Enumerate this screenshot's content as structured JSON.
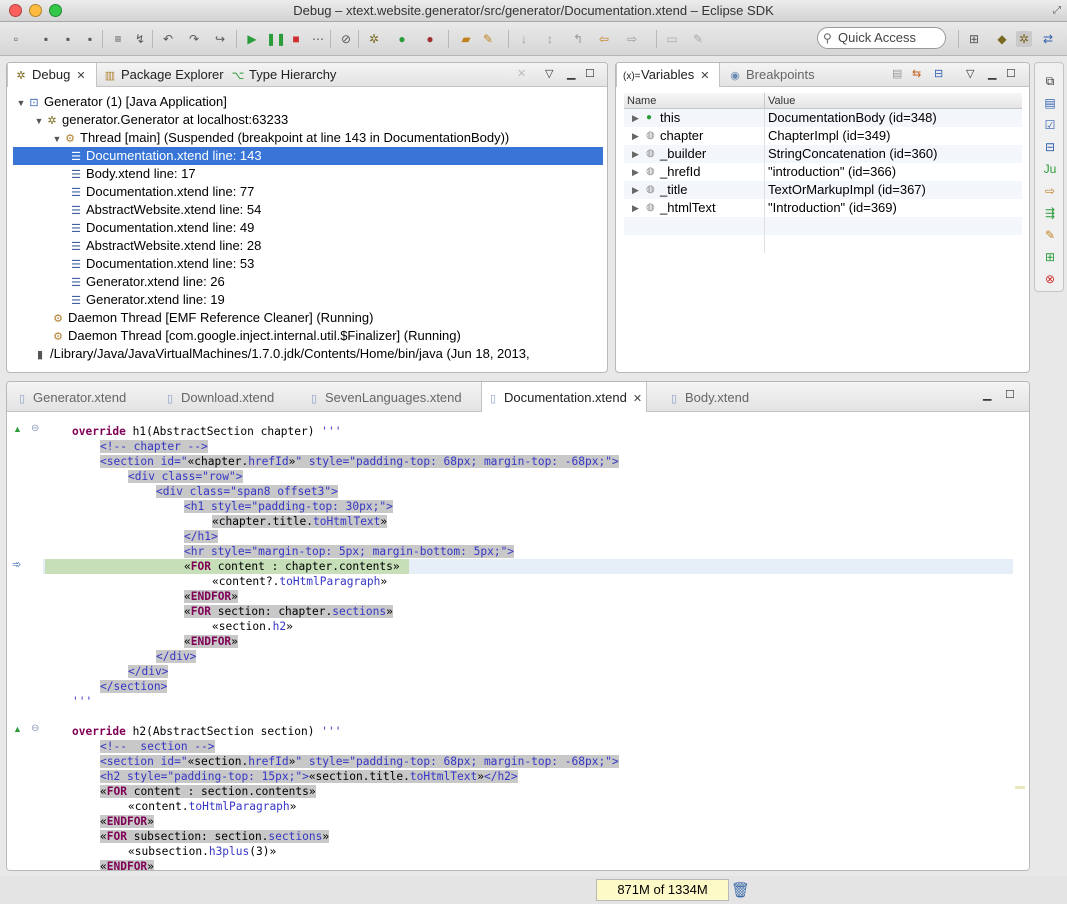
{
  "window": {
    "title": "Debug – xtext.website.generator/src/generator/Documentation.xtend – Eclipse SDK",
    "lights": [
      "#fc605c",
      "#fdbc40",
      "#34c84a"
    ]
  },
  "toolbar": {
    "quick_access_placeholder": "Quick Access",
    "icons": [
      "new-icon",
      "save-icon",
      "save-all-icon",
      "print-icon",
      "toggle-icon",
      "step-filter-icon",
      "drop-frame-icon",
      "step-into-icon",
      "step-over-icon",
      "step-return-icon",
      "resume-icon",
      "suspend-icon",
      "terminate-icon",
      "disconnect-icon",
      "skip-breakpoints-icon",
      "debug-icon",
      "run-icon",
      "external-tools-icon",
      "open-type-icon",
      "search-icon",
      "annotation-icon",
      "next-annotation-icon",
      "prev-annotation-icon",
      "back-icon",
      "forward-icon",
      "pin-icon",
      "perspective-icon",
      "java-perspective-icon",
      "debug-perspective-icon",
      "xtend-perspective-icon"
    ]
  },
  "debug_panel": {
    "tabs": [
      {
        "label": "Debug",
        "icon": "debug-icon"
      },
      {
        "label": "Package Explorer",
        "icon": "package-explorer-icon"
      },
      {
        "label": "Type Hierarchy",
        "icon": "type-hierarchy-icon"
      }
    ],
    "tree": [
      {
        "label": "Generator (1) [Java Application]",
        "icon": "java-app-icon",
        "twisty": "▼"
      },
      {
        "label": "generator.Generator at localhost:63233",
        "icon": "vm-icon",
        "twisty": "▼"
      },
      {
        "label": "Thread [main] (Suspended (breakpoint at line 143 in DocumentationBody))",
        "icon": "thread-suspended-icon",
        "twisty": "▼"
      },
      {
        "label": "Documentation.xtend line: 143",
        "icon": "stack-frame-icon",
        "twisty": "",
        "selected": true
      },
      {
        "label": "Body.xtend line: 17",
        "icon": "stack-frame-icon",
        "twisty": ""
      },
      {
        "label": "Documentation.xtend line: 77",
        "icon": "stack-frame-icon",
        "twisty": ""
      },
      {
        "label": "AbstractWebsite.xtend line: 54",
        "icon": "stack-frame-icon",
        "twisty": ""
      },
      {
        "label": "Documentation.xtend line: 49",
        "icon": "stack-frame-icon",
        "twisty": ""
      },
      {
        "label": "AbstractWebsite.xtend line: 28",
        "icon": "stack-frame-icon",
        "twisty": ""
      },
      {
        "label": "Documentation.xtend line: 53",
        "icon": "stack-frame-icon",
        "twisty": ""
      },
      {
        "label": "Generator.xtend line: 26",
        "icon": "stack-frame-icon",
        "twisty": ""
      },
      {
        "label": "Generator.xtend line: 19",
        "icon": "stack-frame-icon",
        "twisty": ""
      },
      {
        "label": "Daemon Thread [EMF Reference Cleaner] (Running)",
        "icon": "thread-running-icon",
        "twisty": ""
      },
      {
        "label": "Daemon Thread [com.google.inject.internal.util.$Finalizer] (Running)",
        "icon": "thread-running-icon",
        "twisty": ""
      },
      {
        "label": "/Library/Java/JavaVirtualMachines/1.7.0.jdk/Contents/Home/bin/java (Jun 18, 2013,",
        "icon": "process-icon",
        "twisty": ""
      }
    ]
  },
  "variables_panel": {
    "tabs": [
      {
        "label": "Variables",
        "icon": "variables-icon"
      },
      {
        "label": "Breakpoints",
        "icon": "breakpoints-icon"
      }
    ],
    "columns": [
      "Name",
      "Value"
    ],
    "rows": [
      {
        "name": "this",
        "value": "DocumentationBody  (id=348)",
        "icon": "field-icon"
      },
      {
        "name": "chapter",
        "value": "ChapterImpl  (id=349)",
        "icon": "local-var-icon"
      },
      {
        "name": "_builder",
        "value": "StringConcatenation  (id=360)",
        "icon": "local-var-icon"
      },
      {
        "name": "_hrefId",
        "value": "\"introduction\" (id=366)",
        "icon": "local-var-icon"
      },
      {
        "name": "_title",
        "value": "TextOrMarkupImpl  (id=367)",
        "icon": "local-var-icon"
      },
      {
        "name": "_htmlText",
        "value": "\"Introduction\" (id=369)",
        "icon": "local-var-icon"
      }
    ]
  },
  "editor": {
    "tabs": [
      {
        "label": "Generator.xtend",
        "active": false
      },
      {
        "label": "Download.xtend",
        "active": false
      },
      {
        "label": "SevenLanguages.xtend",
        "active": false
      },
      {
        "label": "Documentation.xtend",
        "active": true
      },
      {
        "label": "Body.xtend",
        "active": false
      }
    ],
    "lines": [
      {
        "segs": [
          [
            "kw",
            "override"
          ],
          [
            "",
            " h1(AbstractSection chapter) "
          ],
          [
            "tpl",
            "'''"
          ]
        ],
        "indent": 0,
        "marker": "override"
      },
      {
        "segs": [
          [
            "tpl",
            "<!-- chapter -->"
          ]
        ],
        "indent": 4
      },
      {
        "segs": [
          [
            "tpl",
            "<section id=\""
          ],
          [
            "",
            "«chapter."
          ],
          [
            "tpl",
            "hrefId"
          ],
          [
            "",
            "»"
          ],
          [
            "tpl",
            "\" style=\"padding-top: 68px; margin-top: -68px;\">"
          ]
        ],
        "indent": 4
      },
      {
        "segs": [
          [
            "tpl",
            "<div class=\"row\">"
          ]
        ],
        "indent": 8
      },
      {
        "segs": [
          [
            "tpl",
            "<div class=\"span8 offset3\">"
          ]
        ],
        "indent": 12
      },
      {
        "segs": [
          [
            "tpl",
            "<h1 style=\"padding-top: 30px;\">"
          ]
        ],
        "indent": 16
      },
      {
        "segs": [
          [
            "",
            "«chapter.title."
          ],
          [
            "tpl",
            "toHtmlText"
          ],
          [
            "",
            "»"
          ]
        ],
        "indent": 20
      },
      {
        "segs": [
          [
            "tpl",
            "</h1>"
          ]
        ],
        "indent": 16
      },
      {
        "segs": [
          [
            "tpl",
            "<hr style=\"margin-top: 5px; margin-bottom: 5px;\">"
          ]
        ],
        "indent": 16
      },
      {
        "segs": [
          [
            "",
            "«"
          ],
          [
            "kw",
            "FOR"
          ],
          [
            "",
            " content : chapter.contents»"
          ]
        ],
        "indent": 16,
        "current": true
      },
      {
        "segs": [
          [
            "",
            "«content?."
          ],
          [
            "tpl",
            "toHtmlParagraph"
          ],
          [
            "",
            "»"
          ]
        ],
        "indent": 20
      },
      {
        "segs": [
          [
            "",
            "«"
          ],
          [
            "kw",
            "ENDFOR"
          ],
          [
            "",
            "»"
          ]
        ],
        "indent": 16
      },
      {
        "segs": [
          [
            "",
            "«"
          ],
          [
            "kw",
            "FOR"
          ],
          [
            "",
            " section: chapter."
          ],
          [
            "tpl",
            "sections"
          ],
          [
            "",
            "»"
          ]
        ],
        "indent": 16
      },
      {
        "segs": [
          [
            "",
            "«section."
          ],
          [
            "tpl",
            "h2"
          ],
          [
            "",
            "»"
          ]
        ],
        "indent": 20
      },
      {
        "segs": [
          [
            "",
            "«"
          ],
          [
            "kw",
            "ENDFOR"
          ],
          [
            "",
            "»"
          ]
        ],
        "indent": 16
      },
      {
        "segs": [
          [
            "tpl",
            "</div>"
          ]
        ],
        "indent": 12
      },
      {
        "segs": [
          [
            "tpl",
            "</div>"
          ]
        ],
        "indent": 8
      },
      {
        "segs": [
          [
            "tpl",
            "</section>"
          ]
        ],
        "indent": 4
      },
      {
        "segs": [
          [
            "tpl",
            "'''"
          ]
        ],
        "indent": 0
      },
      {
        "segs": [],
        "indent": 0
      },
      {
        "segs": [
          [
            "kw",
            "override"
          ],
          [
            "",
            " h2(AbstractSection section) "
          ],
          [
            "tpl",
            "'''"
          ]
        ],
        "indent": 0,
        "marker": "override"
      },
      {
        "segs": [
          [
            "tpl",
            "<!--  section -->"
          ]
        ],
        "indent": 4
      },
      {
        "segs": [
          [
            "tpl",
            "<section id=\""
          ],
          [
            "",
            "«section."
          ],
          [
            "tpl",
            "hrefId"
          ],
          [
            "",
            "»"
          ],
          [
            "tpl",
            "\" style=\"padding-top: 68px; margin-top: -68px;\">"
          ]
        ],
        "indent": 4
      },
      {
        "segs": [
          [
            "tpl",
            "<h2 style=\"padding-top: 15px;\">"
          ],
          [
            "",
            "«section.title."
          ],
          [
            "tpl",
            "toHtmlText"
          ],
          [
            "",
            "»"
          ],
          [
            "tpl",
            "</h2>"
          ]
        ],
        "indent": 4
      },
      {
        "segs": [
          [
            "",
            "«"
          ],
          [
            "kw",
            "FOR"
          ],
          [
            "",
            " content : section.contents»"
          ]
        ],
        "indent": 4
      },
      {
        "segs": [
          [
            "",
            "«content."
          ],
          [
            "tpl",
            "toHtmlParagraph"
          ],
          [
            "",
            "»"
          ]
        ],
        "indent": 8
      },
      {
        "segs": [
          [
            "",
            "«"
          ],
          [
            "kw",
            "ENDFOR"
          ],
          [
            "",
            "»"
          ]
        ],
        "indent": 4
      },
      {
        "segs": [
          [
            "",
            "«"
          ],
          [
            "kw",
            "FOR"
          ],
          [
            "",
            " subsection: section."
          ],
          [
            "tpl",
            "sections"
          ],
          [
            "",
            "»"
          ]
        ],
        "indent": 4
      },
      {
        "segs": [
          [
            "",
            "«subsection."
          ],
          [
            "tpl",
            "h3plus"
          ],
          [
            "",
            "(3)»"
          ]
        ],
        "indent": 8
      },
      {
        "segs": [
          [
            "",
            "«"
          ],
          [
            "kw",
            "ENDFOR"
          ],
          [
            "",
            "»"
          ]
        ],
        "indent": 4
      }
    ]
  },
  "status": {
    "heap": "871M of 1334M"
  },
  "right_strip_icons": [
    "restore-icon",
    "console-icon",
    "tasks-icon",
    "outline-icon",
    "junit-icon",
    "call-hierarchy-icon",
    "progress-icon",
    "search-view-icon",
    "problems-icon",
    "error-log-icon"
  ],
  "colors": {
    "selection": "#3875d7",
    "current_line": "#c6dfb8",
    "keyword": "#7f0055",
    "template": "#3636c6"
  }
}
